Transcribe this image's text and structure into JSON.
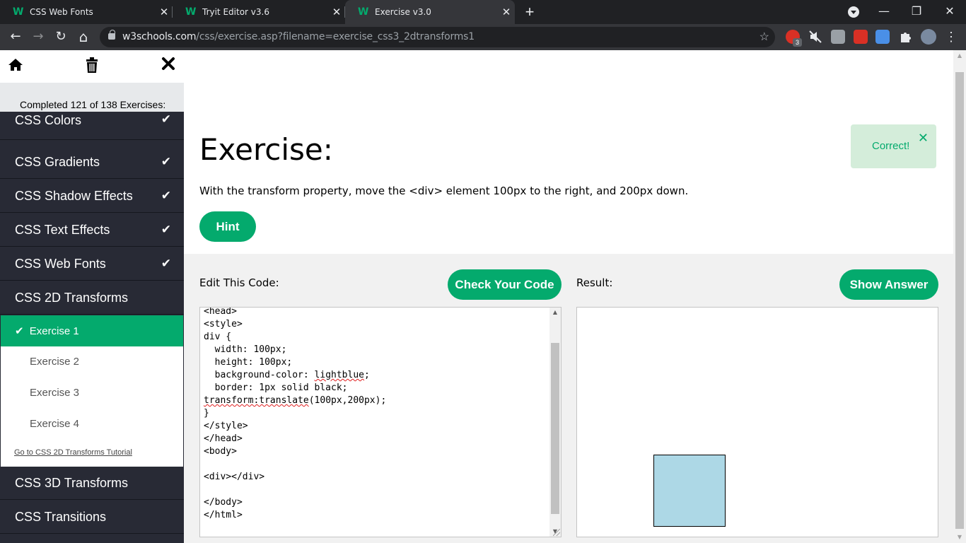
{
  "browser": {
    "tabs": [
      {
        "title": "CSS Web Fonts",
        "active": false
      },
      {
        "title": "Tryit Editor v3.6",
        "active": false
      },
      {
        "title": "Exercise v3.0",
        "active": true
      }
    ],
    "favicon_glyph": "W",
    "close_glyph": "✕",
    "new_tab_glyph": "+",
    "window_controls": {
      "minimize": "—",
      "maximize": "❐",
      "close": "✕"
    },
    "url_host": "w3schools.com",
    "url_path": "/css/exercise.asp?filename=exercise_css3_2dtransforms1",
    "extension_badge": "3",
    "nav_glyphs": {
      "back": "←",
      "forward": "→",
      "reload": "↻",
      "home": "⌂",
      "star": "☆",
      "menu": "⋮"
    }
  },
  "sidebar": {
    "progress_text": "Completed 121 of 138 Exercises:",
    "top_icons": {
      "home": "home-icon",
      "trash": "trash-icon",
      "close": "close-icon"
    },
    "sections_above": [
      {
        "label": "CSS Colors",
        "done": true
      },
      {
        "label": "CSS Gradients",
        "done": true
      },
      {
        "label": "CSS Shadow Effects",
        "done": true
      },
      {
        "label": "CSS Text Effects",
        "done": true
      },
      {
        "label": "CSS Web Fonts",
        "done": true
      },
      {
        "label": "CSS 2D Transforms",
        "done": false
      }
    ],
    "check_glyph": "✔",
    "exercises": [
      {
        "label": "Exercise 1",
        "active": true
      },
      {
        "label": "Exercise 2",
        "active": false
      },
      {
        "label": "Exercise 3",
        "active": false
      },
      {
        "label": "Exercise 4",
        "active": false
      }
    ],
    "tutorial_link": "Go to CSS 2D Transforms Tutorial",
    "sections_below": [
      {
        "label": "CSS 3D Transforms"
      },
      {
        "label": "CSS Transitions"
      }
    ]
  },
  "main": {
    "title": "Exercise:",
    "description": "With the transform property, move the <div> element 100px to the right, and 200px down.",
    "hint_button": "Hint",
    "alert": {
      "text": "Correct!",
      "close": "✕"
    },
    "edit_label": "Edit This Code:",
    "check_button": "Check Your Code",
    "result_label": "Result:",
    "show_answer_button": "Show Answer",
    "code_lines": [
      "<head>",
      "<style>",
      "div {",
      "  width: 100px;",
      "  height: 100px;",
      "  background-color: lightblue;",
      "  border: 1px solid black;",
      "transform:translate(100px,200px);",
      "}",
      "</style>",
      "</head>",
      "<body>",
      "",
      "<div></div>",
      "",
      "</body>",
      "</html>"
    ],
    "preview_div_color": "#add8e6"
  },
  "colors": {
    "accent": "#04aa6d",
    "sidebar_bg": "#282a35",
    "alert_bg": "#d4edda",
    "chrome_bg": "#202124"
  }
}
